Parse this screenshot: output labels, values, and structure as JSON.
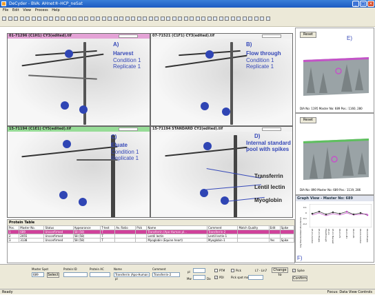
{
  "app": {
    "title": "DeCyder - BVA: AHnet®-HCP_neSat"
  },
  "menu": [
    "File",
    "Edit",
    "View",
    "Process",
    "Help"
  ],
  "gels": [
    {
      "header": "01-71296 (C1H1) CY3(edited).tif",
      "header_color": "#e4a3d6",
      "letter": "A)",
      "name": "Harvest",
      "line1": "Condition 1",
      "line2": "Replicate 1"
    },
    {
      "header": "07-71521 (C1F1) CY3(edited).tif",
      "header_color": "#f1f1f1",
      "letter": "B)",
      "name": "Flow through",
      "line1": "Condition 1",
      "line2": "Replicate 1"
    },
    {
      "header": "15-71194 (C1E1) CY5(edited).tif",
      "header_color": "#97dc97",
      "letter": "C)",
      "name": "Eluate",
      "line1": "Condition 1",
      "line2": "Replicate 1"
    },
    {
      "header": "15-71194 STANDARD CY2(edited).tif",
      "header_color": "#f1f1f1",
      "letter": "D)",
      "name": "Internal standard pool with spikes",
      "line1": "",
      "line2": ""
    }
  ],
  "annotations": {
    "a1": "Transferrin",
    "a2": "Lentil lectin",
    "a3": "Myoglobin"
  },
  "right_panel": {
    "reset1": "Reset",
    "label_e": "E)",
    "info1": "DIA No: 1195  Master No: 689  Pos.: 1160, 280",
    "reset2": "Reset",
    "info2": "DIA No: 890  Master No: 689  Pos.: 1119, 286"
  },
  "graph": {
    "title": "Graph View - Master No: 689",
    "ylabel": "Log Standardized Abundance",
    "label_f": "F)",
    "yticks": [
      "0.1",
      "0",
      "-0.1",
      "-0.2"
    ],
    "xlabels": [
      "05-C1-Control",
      "05-C1 Eluate",
      "05-C1 Flowthrough",
      "05-C1 Harvest",
      "06-C1-F1",
      "06-C1-H1",
      "06-C1-E1",
      "09-C2-Control",
      "09-C2-Eluate"
    ]
  },
  "protein_table": {
    "title": "Protein Table",
    "columns": [
      "Pos.",
      "Master No.",
      "Status",
      "Appearance",
      "T-test",
      "Av. Ratio",
      "Pick",
      "Name",
      "Comment",
      "Match Quality",
      "Edit",
      "Spike"
    ],
    "rows": [
      [
        "1",
        "689",
        "Unconfirmed",
        "58 (58)",
        "T",
        "",
        "",
        "Transferrin (Apo-Human pl...",
        "Transferrin-2",
        "",
        "",
        ""
      ],
      [
        "2",
        "2055",
        "Unconfirmed",
        "58 (58)",
        "T",
        "",
        "",
        "Lentil lectin",
        "Lentil lectin-1",
        "",
        "",
        ""
      ],
      [
        "3",
        "3138",
        "Unconfirmed",
        "58 (58)",
        "T",
        "",
        "",
        "Myoglobin (Equine heart)",
        "Myoglobin-1",
        "",
        "Yes",
        "Spike"
      ]
    ]
  },
  "bottom_form": {
    "master_spot_label": "Master Spot",
    "master_spot_value": "689",
    "select_label": "Select",
    "protein_id_label": "Protein ID",
    "protein_ac_label": "Protein AC",
    "name_label": "Name",
    "name_value": "Transferrin (Apo-Human pl",
    "comment_label": "Comment",
    "comment_value": "Transferrin-2",
    "pi_label": "pI",
    "mw_label": "Mw",
    "da_label": "Da",
    "ptm_label": "PTM",
    "pdi_label": "PDI",
    "pick_label": "Pick",
    "pick_spot_map": "Pick spot map",
    "change_label": "L7 - Lin7",
    "change_btn": "Change to",
    "spike_label": "Spike",
    "confirm_label": "Confirm"
  },
  "status": {
    "left": "Ready",
    "right": "Focus: Data View Controls"
  }
}
